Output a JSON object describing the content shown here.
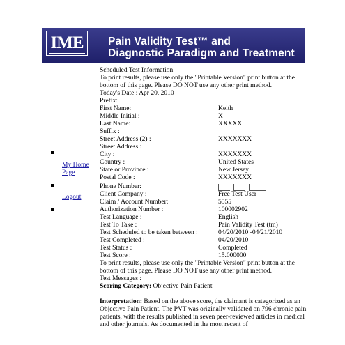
{
  "header": {
    "logo_text": "IME",
    "title_line1": "Pain Validity Test™ and",
    "title_line2": "Diagnostic Paradigm and Treatment"
  },
  "nav": {
    "links": [
      "My Home Page",
      "Logout"
    ]
  },
  "content": {
    "section_title": "Scheduled Test Information",
    "print_notice": "To print results, please use only the \"Printable Version\" print button at the bottom of this page. Please DO NOT use any other print method.",
    "today_date": "Today's Date : Apr 20, 2010",
    "prefix_label": "Prefix:",
    "fields_a": [
      {
        "label": "First Name:",
        "value": "Keith"
      },
      {
        "label": "Middle Initial :",
        "value": "X"
      },
      {
        "label": "Last Name:",
        "value": "XXXXX"
      },
      {
        "label": "Suffix :",
        "value": ""
      },
      {
        "label": "Street Address (2) :",
        "value": "XXXXXXX"
      },
      {
        "label": "Street Address :",
        "value": ""
      },
      {
        "label": "City :",
        "value": "XXXXXXX"
      },
      {
        "label": "Country :",
        "value": "United States"
      },
      {
        "label": "State or Province :",
        "value": "New Jersey"
      },
      {
        "label": "Postal Code :",
        "value": "XXXXXXX"
      }
    ],
    "phone_label": "Phone Number:",
    "fields_b": [
      {
        "label": "Client Company :",
        "value": "Free Test User"
      },
      {
        "label": "Claim / Account Number:",
        "value": "5555"
      },
      {
        "label": "Authorization Number :",
        "value": "100002902"
      },
      {
        "label": "Test Language :",
        "value": "English"
      },
      {
        "label": "Test To Take :",
        "value": "Pain Validity Test (tm)"
      },
      {
        "label": "Test Scheduled to be taken between :",
        "value": "04/20/2010 -04/21/2010"
      },
      {
        "label": "Test Completed :",
        "value": "04/20/2010"
      },
      {
        "label": "Test Status :",
        "value": "Completed"
      },
      {
        "label": "Test Score :",
        "value": "15.000000"
      }
    ],
    "print_notice_2": "To print results, please use only the \"Printable Version\" print button at the bottom of this page. Please DO NOT use any other print method.",
    "test_messages": "Test Messages :",
    "scoring_category_label": "Scoring Category:",
    "scoring_category_value": "Objective Pain Patient",
    "interpretation_label": "Interpretation:",
    "interpretation_text": "Based on the above score, the claimant is categorized as an Objective Pain Patient. The PVT was originally validated on 796 chronic pain patients, with the results published in seven peer-reviewed articles in medical and other journals. As documented in the most recent of"
  }
}
